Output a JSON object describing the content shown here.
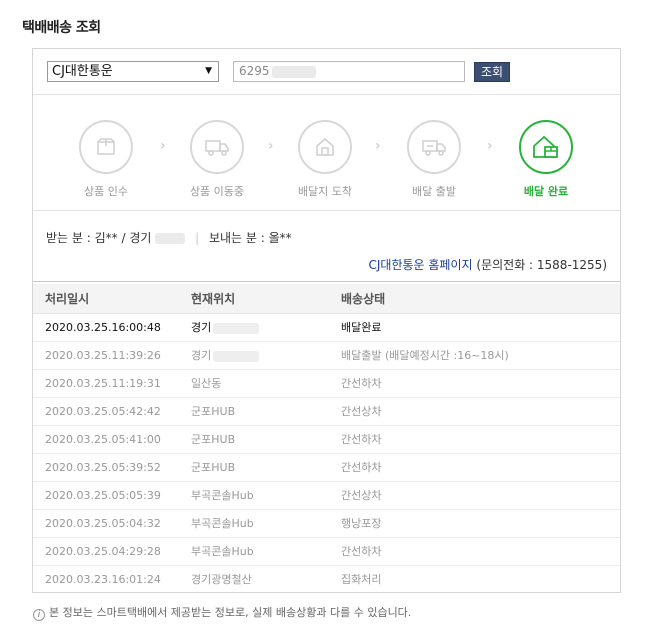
{
  "page_title": "택배배송 조회",
  "search": {
    "carrier_selected": "CJ대한통운",
    "invoice_value": "6295",
    "button_label": "조회"
  },
  "steps": [
    {
      "label": "상품 인수",
      "icon": "box-icon",
      "active": false
    },
    {
      "label": "상품 이동중",
      "icon": "truck-icon",
      "active": false
    },
    {
      "label": "배달지 도착",
      "icon": "house-icon",
      "active": false
    },
    {
      "label": "배달 출발",
      "icon": "delivery-truck-icon",
      "active": false
    },
    {
      "label": "배달 완료",
      "icon": "delivered-house-icon",
      "active": true
    }
  ],
  "info": {
    "receiver_prefix": "받는 분 : 김** / 경기",
    "sender": "보내는 분 : 올**",
    "carrier_link": "CJ대한통운 홈페이지",
    "phone": "(문의전화 : 1588-1255)"
  },
  "table": {
    "headers": [
      "처리일시",
      "현재위치",
      "배송상태"
    ],
    "rows": [
      {
        "time": "2020.03.25.16:00:48",
        "location": "경기",
        "status": "배달완료"
      },
      {
        "time": "2020.03.25.11:39:26",
        "location": "경기",
        "status": "배달출발 (배달예정시간 :16~18시)"
      },
      {
        "time": "2020.03.25.11:19:31",
        "location": "일산동",
        "status": "간선하차"
      },
      {
        "time": "2020.03.25.05:42:42",
        "location": "군포HUB",
        "status": "간선상차"
      },
      {
        "time": "2020.03.25.05:41:00",
        "location": "군포HUB",
        "status": "간선하차"
      },
      {
        "time": "2020.03.25.05:39:52",
        "location": "군포HUB",
        "status": "간선하차"
      },
      {
        "time": "2020.03.25.05:05:39",
        "location": "부곡콘솔Hub",
        "status": "간선상차"
      },
      {
        "time": "2020.03.25.05:04:32",
        "location": "부곡콘솔Hub",
        "status": "행낭포장"
      },
      {
        "time": "2020.03.25.04:29:28",
        "location": "부곡콘솔Hub",
        "status": "간선하차"
      },
      {
        "time": "2020.03.23.16:01:24",
        "location": "경기광명철산",
        "status": "집화처리"
      }
    ]
  },
  "notice": "본 정보는 스마트택배에서 제공받는 정보로, 실제 배송상황과 다를 수 있습니다."
}
